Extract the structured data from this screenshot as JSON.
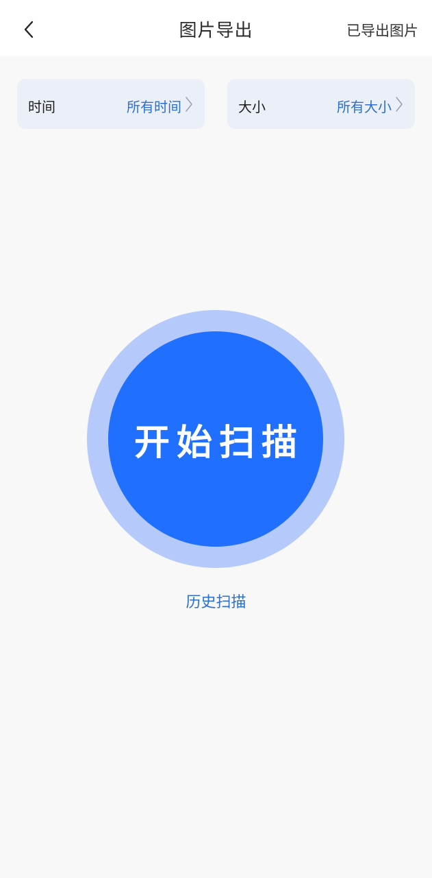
{
  "header": {
    "back_icon": "chevron-left-icon",
    "title": "图片导出",
    "exported_label": "已导出图片"
  },
  "filters": {
    "time": {
      "label": "时间",
      "value": "所有时间",
      "icon": "chevron-right-icon"
    },
    "size": {
      "label": "大小",
      "value": "所有大小",
      "icon": "chevron-right-icon"
    }
  },
  "scan": {
    "button_label": "开始扫描",
    "history_label": "历史扫描"
  },
  "colors": {
    "primary": "#216ffe",
    "ring": "#b5c9fb",
    "link": "#2c6fd1",
    "card": "#ebf0f8",
    "background": "#f8f8f8"
  }
}
